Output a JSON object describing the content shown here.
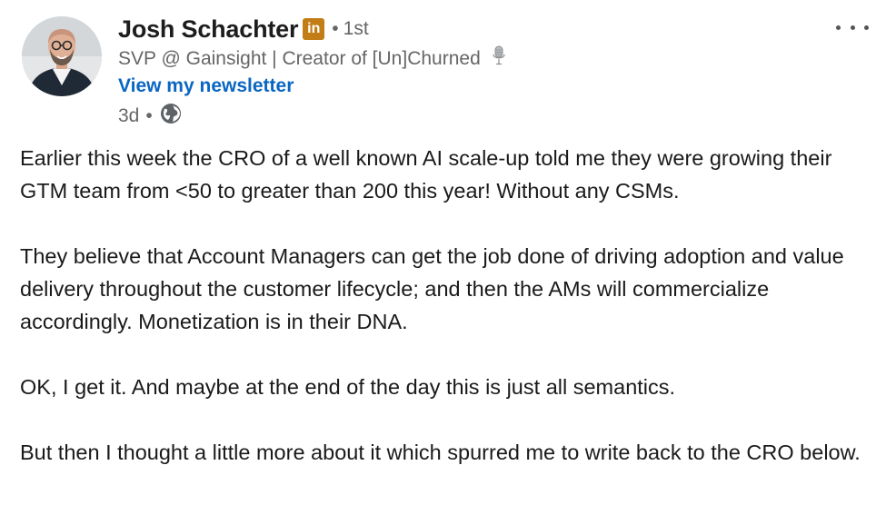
{
  "author": {
    "name": "Josh Schachter",
    "badge": "in",
    "degree_separator": "•",
    "degree": "1st",
    "headline": "SVP @ Gainsight | Creator of [Un]Churned",
    "newsletter_link": "View my newsletter",
    "time_ago": "3d",
    "meta_separator": "•",
    "visibility_icon": "globe-icon"
  },
  "post": {
    "paragraphs": [
      "Earlier this week the CRO of a well known AI scale-up told me they were growing their GTM team from <50 to greater than 200 this year! Without any CSMs.",
      "They believe that Account Managers can get the job done of driving adoption and value delivery throughout the customer lifecycle; and then the AMs will commercialize accordingly. Monetization is in their DNA.",
      "OK, I get it. And maybe at the end of the day this is just all semantics.",
      "But then I thought a little more about it which spurred me to write back to the CRO below."
    ]
  },
  "colors": {
    "link_blue": "#0a66c2",
    "badge_gold": "#c37d16",
    "muted_text": "#666666"
  }
}
